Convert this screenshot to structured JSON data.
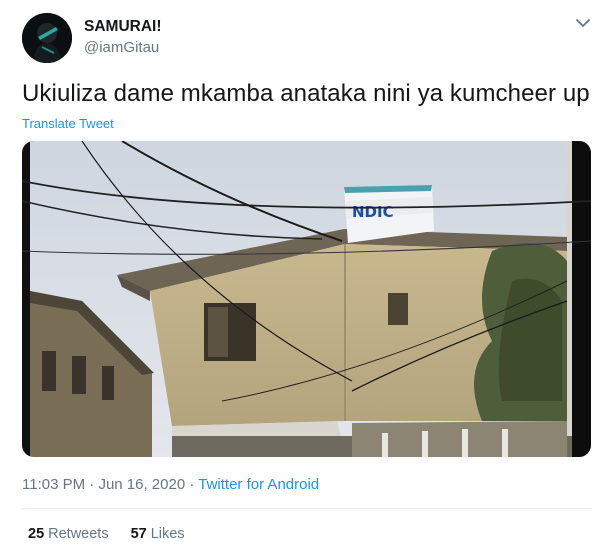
{
  "author": {
    "name": "SAMURAI!",
    "handle": "@iamGitau"
  },
  "tweet": {
    "text": "Ukiuliza dame mkamba anataka nini ya kumcheer up",
    "translate_label": "Translate Tweet",
    "media_sign_text": "NDIC"
  },
  "meta": {
    "time": "11:03 PM",
    "sep1": " · ",
    "date": "Jun 16, 2020",
    "sep2": " · ",
    "source": "Twitter for Android"
  },
  "stats": {
    "retweets_count": "25",
    "retweets_label": "Retweets",
    "likes_count": "57",
    "likes_label": "Likes"
  },
  "icons": {
    "menu": "chevron-down-icon",
    "avatar": "avatar"
  },
  "colors": {
    "link": "#1b95e0",
    "secondary": "#657786",
    "primary": "#14171a"
  }
}
